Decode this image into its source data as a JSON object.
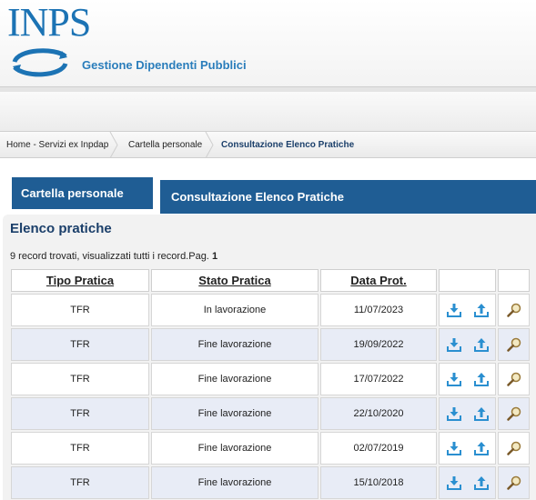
{
  "header": {
    "logo_text": "INPS",
    "app_title": "Gestione Dipendenti Pubblici"
  },
  "breadcrumb": {
    "items": [
      "Home - Servizi ex Inpdap",
      "Cartella personale",
      "Consultazione Elenco Pratiche"
    ]
  },
  "tabs": {
    "left": "Cartella personale",
    "right": "Consultazione Elenco Pratiche"
  },
  "panel": {
    "title": "Elenco pratiche",
    "record_info": "9 record trovati, visualizzati tutti i record.Pag.",
    "page_number": "1"
  },
  "table": {
    "headers": [
      "Tipo Pratica",
      "Stato Pratica",
      "Data Prot."
    ],
    "rows": [
      {
        "tipo": "TFR",
        "stato": "In lavorazione",
        "data": "11/07/2023"
      },
      {
        "tipo": "TFR",
        "stato": "Fine lavorazione",
        "data": "19/09/2022"
      },
      {
        "tipo": "TFR",
        "stato": "Fine lavorazione",
        "data": "17/07/2022"
      },
      {
        "tipo": "TFR",
        "stato": "Fine lavorazione",
        "data": "22/10/2020"
      },
      {
        "tipo": "TFR",
        "stato": "Fine lavorazione",
        "data": "02/07/2019"
      },
      {
        "tipo": "TFR",
        "stato": "Fine lavorazione",
        "data": "15/10/2018"
      }
    ],
    "row_icons": [
      "download-icon",
      "upload-icon",
      "magnifier-icon"
    ]
  },
  "colors": {
    "brand_blue": "#1c73b4",
    "tab_blue": "#1f5d94",
    "title_blue": "#1b3f6a",
    "row_alt": "#e8ecf6",
    "icon_blue": "#2a8fd0"
  }
}
